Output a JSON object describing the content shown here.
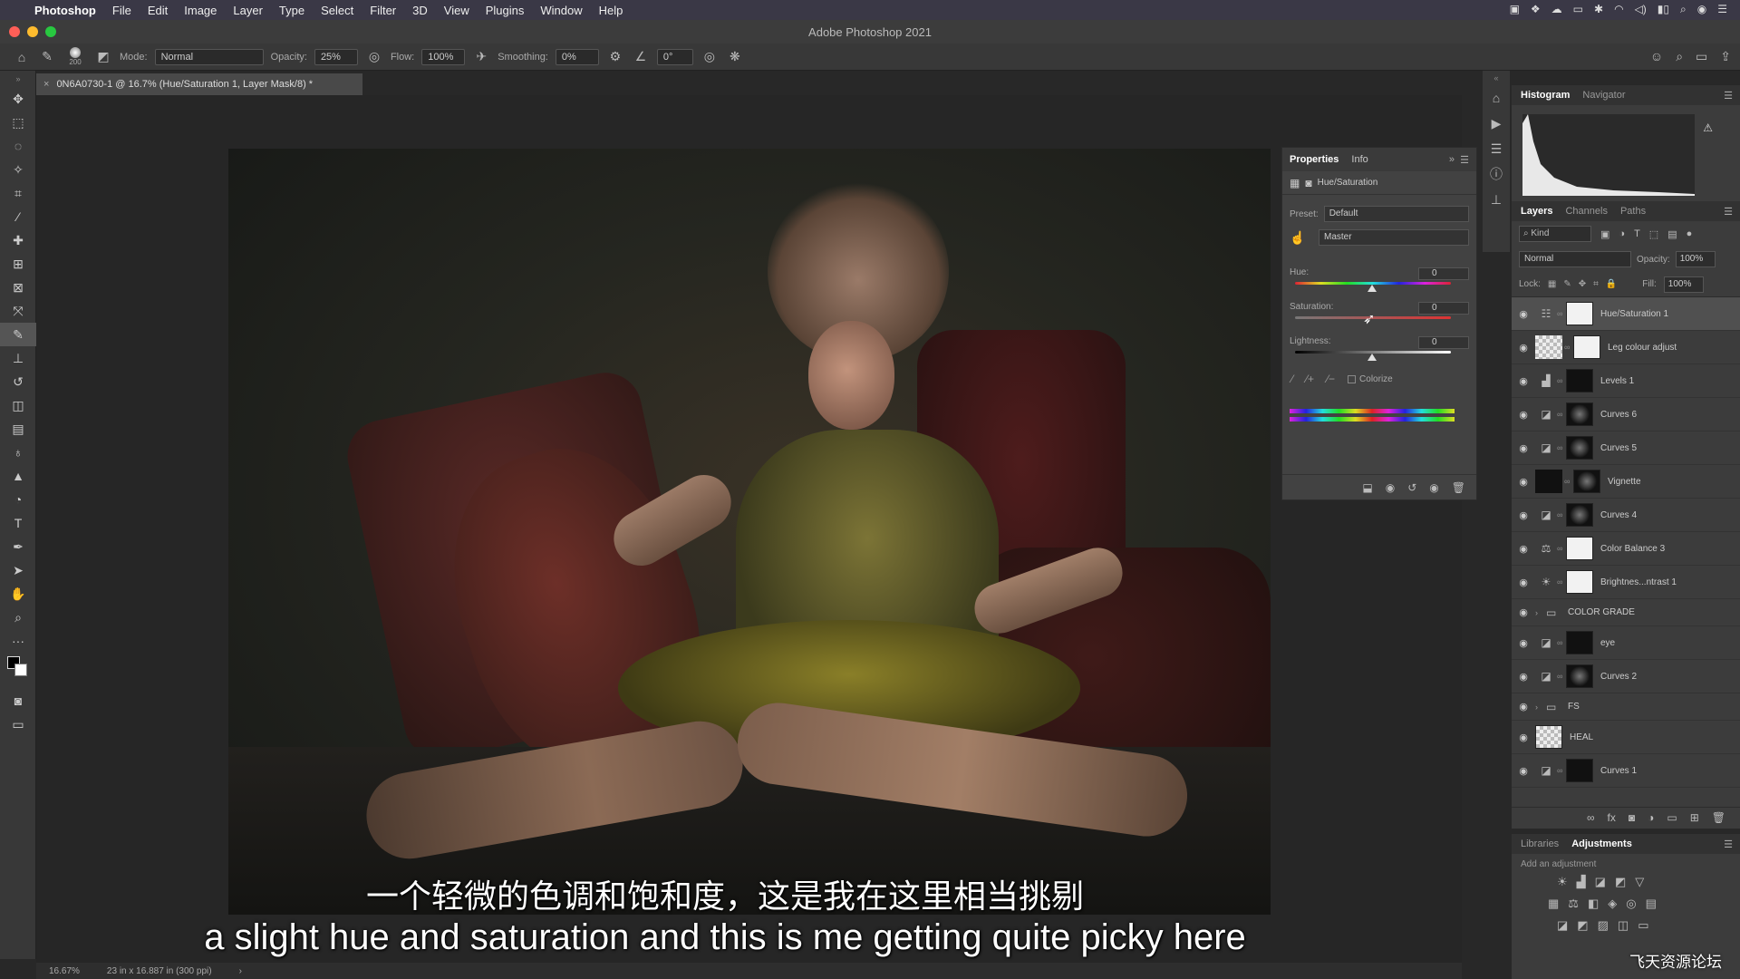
{
  "menubar": {
    "apple_icon": "apple-icon",
    "app_name": "Photoshop",
    "items": [
      "File",
      "Edit",
      "Image",
      "Layer",
      "Type",
      "Select",
      "Filter",
      "3D",
      "View",
      "Plugins",
      "Window",
      "Help"
    ]
  },
  "window": {
    "title": "Adobe Photoshop 2021"
  },
  "options": {
    "brush_size": "200",
    "mode_label": "Mode:",
    "mode_value": "Normal",
    "opacity_label": "Opacity:",
    "opacity_value": "25%",
    "flow_label": "Flow:",
    "flow_value": "100%",
    "smoothing_label": "Smoothing:",
    "smoothing_value": "0%",
    "angle_value": "0°"
  },
  "document": {
    "tab_title": "0N6A0730-1 @ 16.7% (Hue/Saturation 1, Layer Mask/8) *",
    "zoom": "16.67%",
    "doc_info": "23 in x 16.887 in (300 ppi)"
  },
  "properties": {
    "tab_active": "Properties",
    "tab_other": "Info",
    "adjustment_name": "Hue/Saturation",
    "preset_label": "Preset:",
    "preset_value": "Default",
    "channel_value": "Master",
    "hue_label": "Hue:",
    "hue_value": "0",
    "saturation_label": "Saturation:",
    "saturation_value": "0",
    "lightness_label": "Lightness:",
    "lightness_value": "0",
    "colorize_label": "Colorize"
  },
  "histogram_panel": {
    "tab_active": "Histogram",
    "tab_other": "Navigator"
  },
  "layers_panel": {
    "tabs": [
      "Layers",
      "Channels",
      "Paths"
    ],
    "kind_label": "Kind",
    "blend_mode": "Normal",
    "opacity_label": "Opacity:",
    "opacity_value": "100%",
    "lock_label": "Lock:",
    "fill_label": "Fill:",
    "fill_value": "100%",
    "layers": [
      {
        "name": "Hue/Saturation 1",
        "adj": "☷",
        "mask": "white",
        "selected": true
      },
      {
        "name": "Leg colour adjust",
        "adj": "",
        "mask": "white",
        "selected": false
      },
      {
        "name": "Levels 1",
        "adj": "▟",
        "mask": "black",
        "selected": false
      },
      {
        "name": "Curves 6",
        "adj": "◪",
        "mask": "dark",
        "selected": false
      },
      {
        "name": "Curves 5",
        "adj": "◪",
        "mask": "dark",
        "selected": false
      },
      {
        "name": "Vignette",
        "adj": "",
        "mask": "dark",
        "selected": false
      },
      {
        "name": "Curves 4",
        "adj": "◪",
        "mask": "dark",
        "selected": false
      },
      {
        "name": "Color Balance 3",
        "adj": "⚖",
        "mask": "white",
        "selected": false
      },
      {
        "name": "Brightnes...ntrast 1",
        "adj": "☀",
        "mask": "white",
        "selected": false
      },
      {
        "name": "COLOR GRADE",
        "adj": "group",
        "mask": "none",
        "selected": false
      },
      {
        "name": "eye",
        "adj": "◪",
        "mask": "black",
        "selected": false
      },
      {
        "name": "Curves 2",
        "adj": "◪",
        "mask": "dark",
        "selected": false
      },
      {
        "name": "FS",
        "adj": "group",
        "mask": "none",
        "selected": false
      },
      {
        "name": "HEAL",
        "adj": "",
        "mask": "none",
        "selected": false
      },
      {
        "name": "Curves 1",
        "adj": "◪",
        "mask": "black",
        "selected": false
      }
    ]
  },
  "adjust_panel": {
    "tab_other": "Libraries",
    "tab_active": "Adjustments",
    "hint": "Add an adjustment"
  },
  "subtitles": {
    "chinese": "一个轻微的色调和饱和度，这是我在这里相当挑剔",
    "english": "a slight hue and saturation and this is me getting quite picky here"
  },
  "watermark": "飞天资源论坛"
}
